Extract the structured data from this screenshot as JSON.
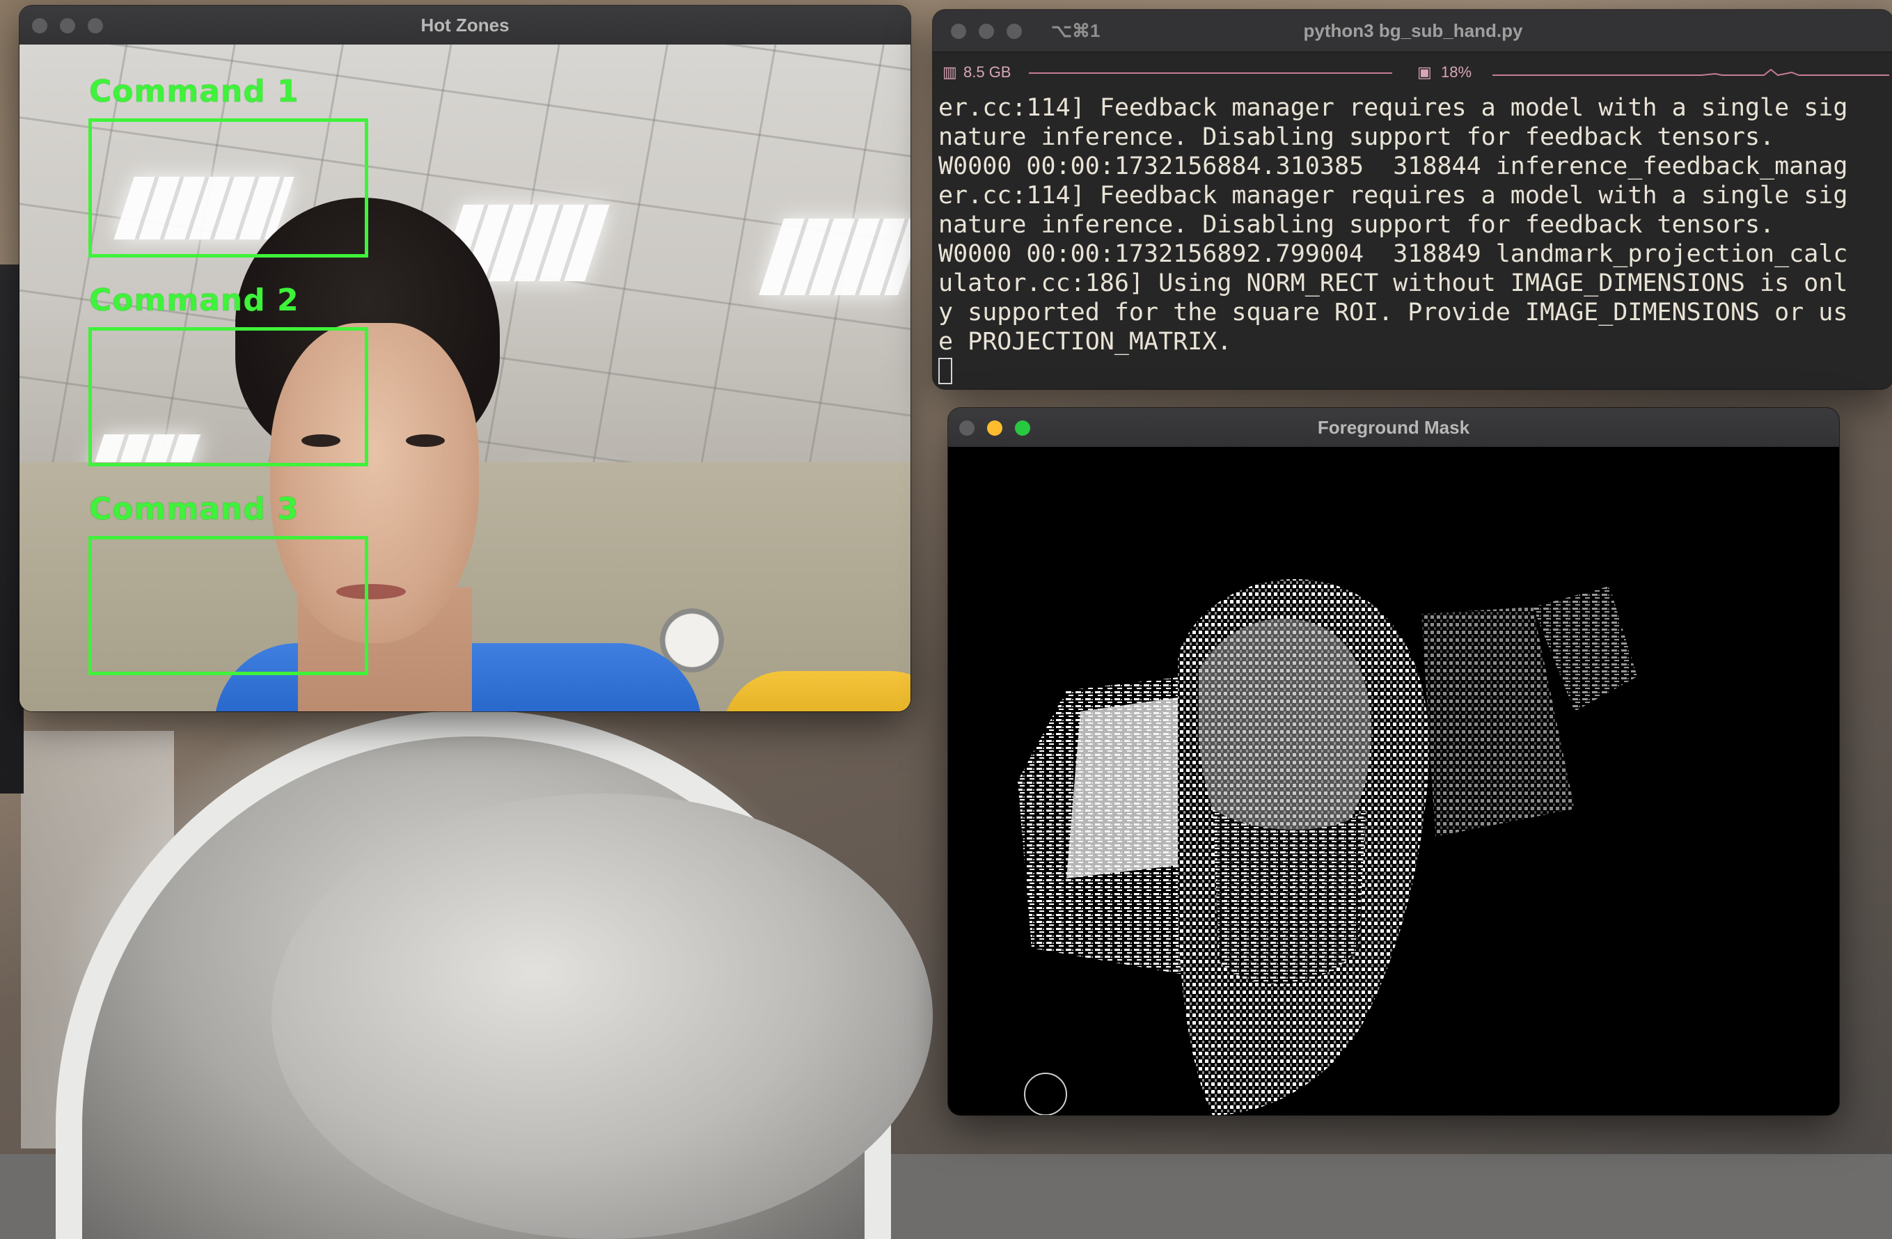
{
  "hot_zones": {
    "title": "Hot Zones",
    "zones": [
      {
        "label": "Command 1"
      },
      {
        "label": "Command 2"
      },
      {
        "label": "Command 3"
      }
    ],
    "zone_color": "#3ff23a"
  },
  "terminal": {
    "shortcut": "⌥⌘1",
    "title": "python3 bg_sub_hand.py",
    "memory": "8.5 GB",
    "cpu": "18%",
    "lines": [
      "er.cc:114] Feedback manager requires a model with a single sig",
      "nature inference. Disabling support for feedback tensors.",
      "W0000 00:00:1732156884.310385  318844 inference_feedback_manag",
      "er.cc:114] Feedback manager requires a model with a single sig",
      "nature inference. Disabling support for feedback tensors.",
      "W0000 00:00:1732156892.799004  318849 landmark_projection_calc",
      "ulator.cc:186] Using NORM_RECT without IMAGE_DIMENSIONS is onl",
      "y supported for the square ROI. Provide IMAGE_DIMENSIONS or us",
      "e PROJECTION_MATRIX."
    ]
  },
  "foreground_mask": {
    "title": "Foreground Mask"
  },
  "colors": {
    "close": "#5d5d60",
    "minimize": "#febc2e",
    "maximize": "#28c840"
  }
}
